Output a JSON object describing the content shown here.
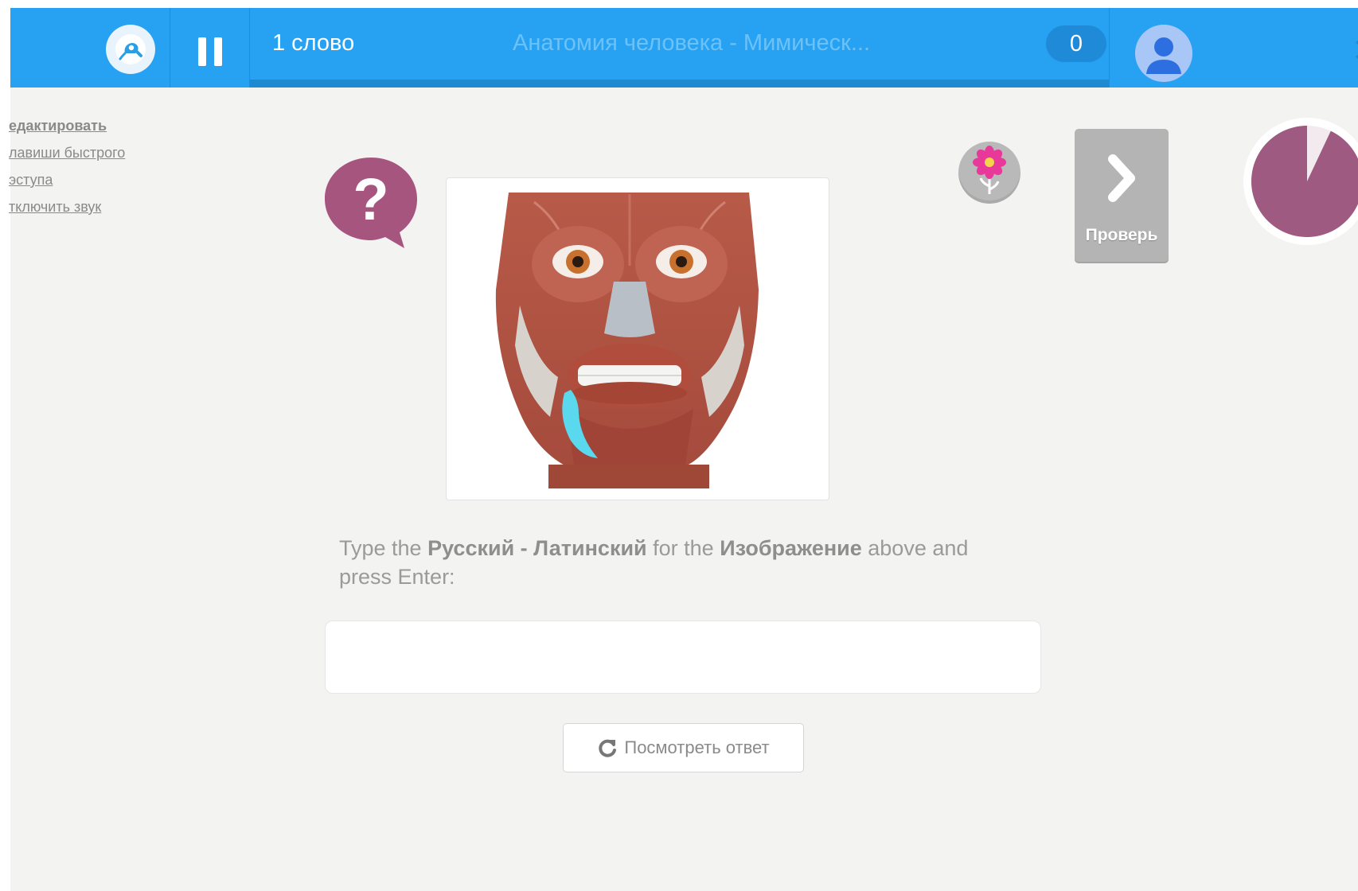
{
  "header": {
    "word_count": "1 слово",
    "course_title": "Анатомия человека - Мимическ...",
    "score": "0",
    "close_glyph": "✕",
    "icons": {
      "logo": "watering-can-icon",
      "pause": "pause-icon",
      "avatar": "user-avatar-icon"
    }
  },
  "sidebar": {
    "links": [
      {
        "label": "едактировать"
      },
      {
        "label": "лавиши быстрого"
      },
      {
        "label": "эступа"
      },
      {
        "label": "тключить звук"
      }
    ]
  },
  "main": {
    "question_icon": "question-bubble-icon",
    "image_subject": "face-muscles-image",
    "prompt": {
      "p1": "Type the ",
      "b1": "Русский - Латинский",
      "p2": " for the ",
      "b2": "Изображение",
      "p3": " above and press Enter:"
    },
    "answer_input": {
      "value": "",
      "placeholder": ""
    },
    "show_answer_label": "Посмотреть ответ"
  },
  "right_panel": {
    "flower_icon": "flower-icon",
    "next_label": "Проверь",
    "timer_remaining_fraction": 0.93
  },
  "colors": {
    "header_bg": "#27a2f2",
    "progress_track": "#1e8ad2",
    "accent_purple": "#a5557e",
    "timer_purple": "#9e5a80",
    "page_bg": "#f3f3f2"
  }
}
